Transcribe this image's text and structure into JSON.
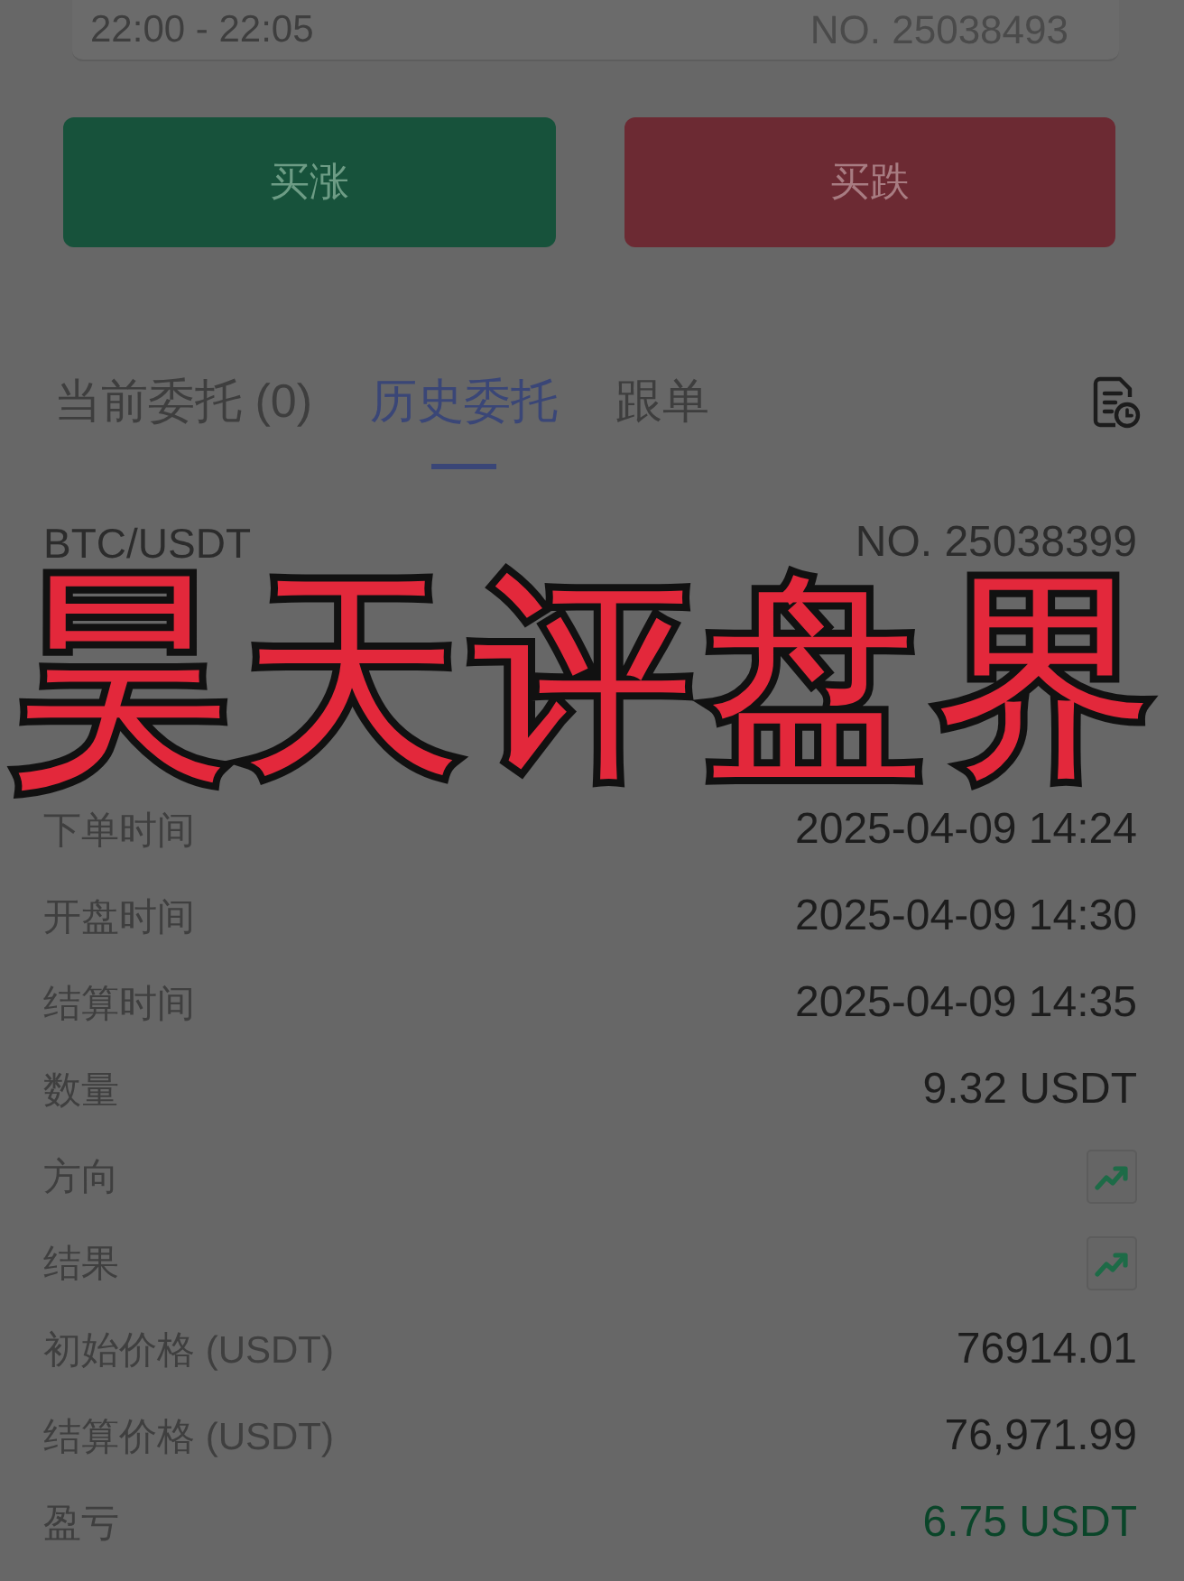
{
  "order_header": {
    "time_range": "22:00 - 22:05",
    "order_no": "NO. 25038493"
  },
  "buttons": [
    {
      "label": "买涨",
      "kind": "rise"
    },
    {
      "label": "买跌",
      "kind": "fall"
    }
  ],
  "tabs": [
    {
      "label": "当前委托 (0)",
      "selected": false
    },
    {
      "label": "历史委托",
      "selected": true
    },
    {
      "label": "跟单",
      "selected": false
    }
  ],
  "record": {
    "pair": "BTC/USDT",
    "order_no": "NO. 25038399",
    "rows": [
      {
        "label": "下单时间",
        "kind": "text",
        "value": "2025-04-09 14:24"
      },
      {
        "label": "开盘时间",
        "kind": "text",
        "value": "2025-04-09 14:30"
      },
      {
        "label": "结算时间",
        "kind": "text",
        "value": "2025-04-09 14:35"
      },
      {
        "label": "数量",
        "kind": "text",
        "value": "9.32 USDT"
      },
      {
        "label": "方向",
        "kind": "trend",
        "rising": true
      },
      {
        "label": "结果",
        "kind": "trend",
        "rising": true
      },
      {
        "label": "初始价格 (USDT)",
        "kind": "text",
        "value": "76914.01"
      },
      {
        "label": "结算价格 (USDT)",
        "kind": "text",
        "value": "76,971.99"
      },
      {
        "label": "盈亏",
        "kind": "text",
        "value": "6.75 USDT",
        "profit": true
      }
    ]
  },
  "overlay_caption": {
    "text": "昊天评盘界"
  }
}
